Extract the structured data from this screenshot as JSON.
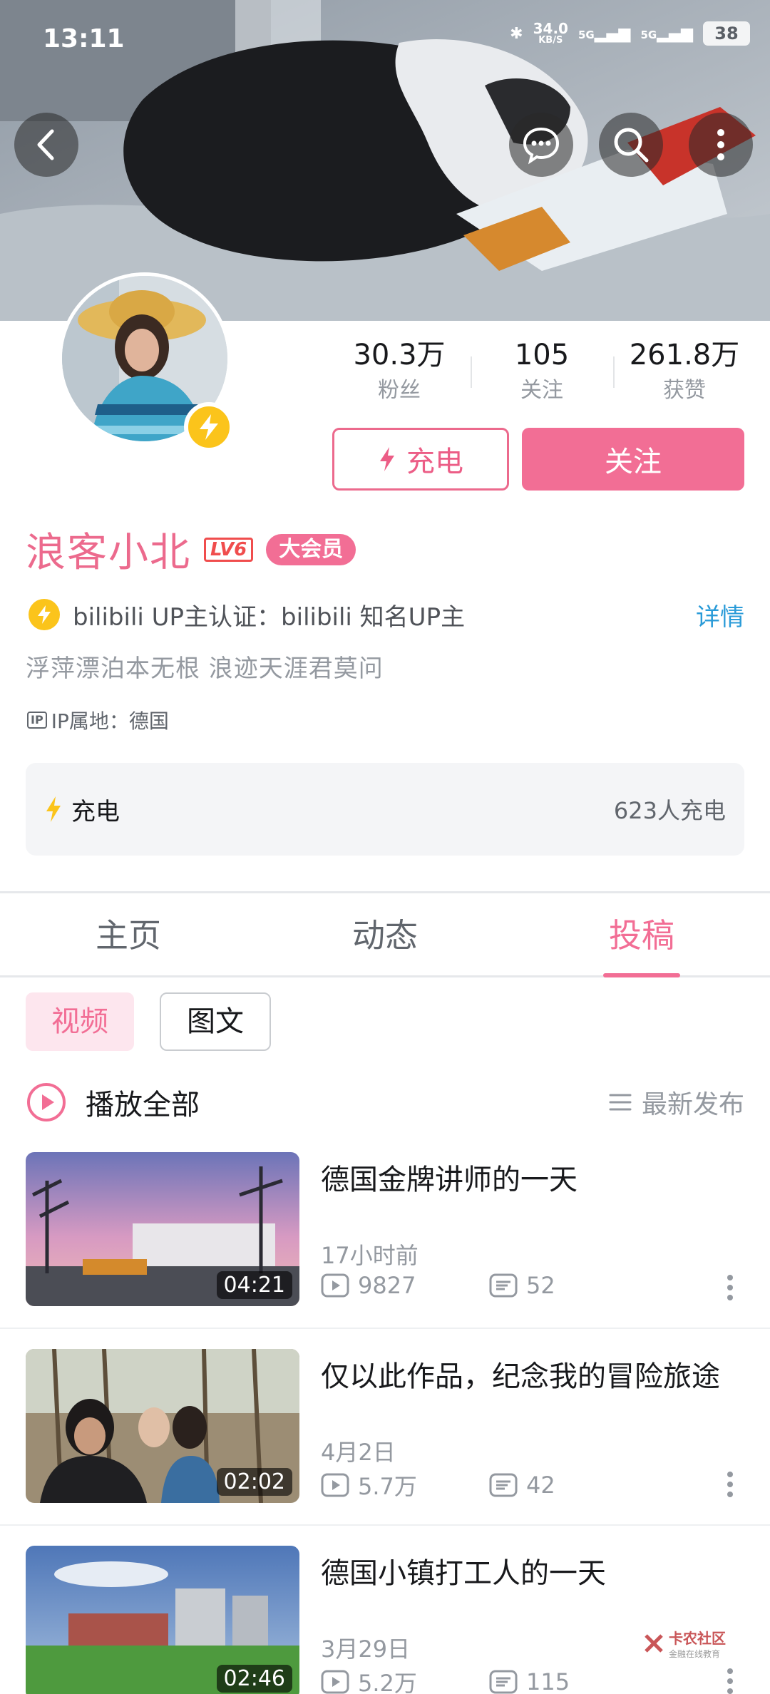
{
  "status_bar": {
    "time": "13:11",
    "speed": "34.0",
    "speed_unit": "KB/S",
    "network_1": "5G",
    "network_2": "5G",
    "battery": "38"
  },
  "header": {
    "back_icon": "back-arrow-icon",
    "message_icon": "chat-bubble-icon",
    "search_icon": "search-icon",
    "more_icon": "more-vertical-icon"
  },
  "profile": {
    "stats": [
      {
        "value": "30.3万",
        "label": "粉丝"
      },
      {
        "value": "105",
        "label": "关注"
      },
      {
        "value": "261.8万",
        "label": "获赞"
      }
    ],
    "charge_button": "充电",
    "follow_button": "关注",
    "name": "浪客小北",
    "level": "LV6",
    "vip_badge": "大会员",
    "certification": "bilibili UP主认证：bilibili 知名UP主",
    "cert_detail_link": "详情",
    "bio": "浮萍漂泊本无根 浪迹天涯君莫问",
    "ip_icon_text": "IP",
    "ip_location": "IP属地：德国",
    "charge_card": {
      "title": "充电",
      "count": "623人充电"
    }
  },
  "tabs": [
    {
      "label": "主页",
      "active": false
    },
    {
      "label": "动态",
      "active": false
    },
    {
      "label": "投稿",
      "active": true
    }
  ],
  "filter_chips": [
    {
      "label": "视频",
      "active": true
    },
    {
      "label": "图文",
      "active": false
    }
  ],
  "list_header": {
    "play_all": "播放全部",
    "sort_label": "最新发布"
  },
  "videos": [
    {
      "title": "德国金牌讲师的一天",
      "duration": "04:21",
      "date": "17小时前",
      "views": "9827",
      "comments": "52"
    },
    {
      "title": "仅以此作品，纪念我的冒险旅途",
      "duration": "02:02",
      "date": "4月2日",
      "views": "5.7万",
      "comments": "42"
    },
    {
      "title": "德国小镇打工人的一天",
      "duration": "02:46",
      "date": "3月29日",
      "views": "5.2万",
      "comments": "115"
    }
  ],
  "watermark": {
    "title": "卡农社区",
    "subtitle": "金融在线教育"
  },
  "colors": {
    "accent_pink": "#f26e95",
    "link_blue": "#2a9bd8",
    "charge_yellow": "#fbc41b",
    "text_gray": "#9499a0"
  }
}
